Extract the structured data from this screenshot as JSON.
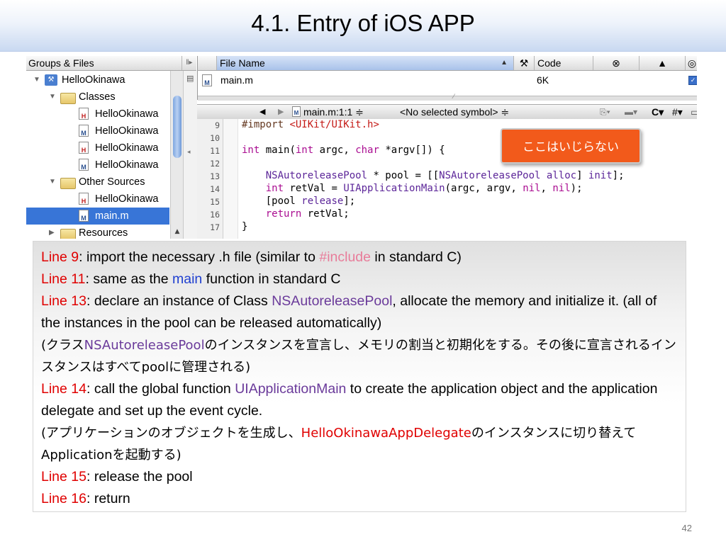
{
  "title": "4.1. Entry of iOS APP",
  "sidebar": {
    "header": "Groups & Files",
    "items": [
      {
        "label": "HelloOkinawa",
        "icon": "project-icon"
      },
      {
        "label": "Classes",
        "icon": "folder-icon"
      },
      {
        "label": "HelloOkinawa",
        "icon": "h-file-icon"
      },
      {
        "label": "HelloOkinawa",
        "icon": "m-file-icon"
      },
      {
        "label": "HelloOkinawa",
        "icon": "h-file-icon"
      },
      {
        "label": "HelloOkinawa",
        "icon": "m-file-icon"
      },
      {
        "label": "Other Sources",
        "icon": "folder-icon"
      },
      {
        "label": "HelloOkinawa",
        "icon": "h-file-icon"
      },
      {
        "label": "main.m",
        "icon": "m-file-icon"
      },
      {
        "label": "Resources",
        "icon": "folder-icon"
      }
    ]
  },
  "file_list": {
    "col_file_name": "File Name",
    "col_code": "Code",
    "row_file": "main.m",
    "row_code": "6K"
  },
  "navbar": {
    "location": "main.m:1:1 ≑",
    "symbol": "<No selected symbol> ≑",
    "c_menu": "C",
    "hash_menu": "#"
  },
  "editor": {
    "line_numbers": [
      "9",
      "10",
      "11",
      "12",
      "13",
      "14",
      "15",
      "16",
      "17"
    ]
  },
  "callout": "ここはいじらない",
  "explanation": {
    "line9_label": "Line 9",
    "line9_a": ": import the necessary .h file (similar to ",
    "line9_kw": "#include",
    "line9_b": " in standard C)",
    "line11_label": "Line 11",
    "line11_a": ": same as the ",
    "line11_kw": "main",
    "line11_b": " function in standard C",
    "line13_label": "Line 13",
    "line13_a": ": declare an instance of Class ",
    "line13_kw": "NSAutoreleasePool",
    "line13_b": ", allocate the memory and initialize it. (all of the instances in the pool can be released automatically)",
    "jp1_a": "(クラス",
    "jp1_kw": "NSAutoreleasePool",
    "jp1_b": "のインスタンスを宣言し、メモリの割当と初期化をする。その後に宣言されるインスタンスはすべてpoolに管理される)",
    "line14_label": "Line 14",
    "line14_a": ": call the global function ",
    "line14_kw": "UIApplicationMain",
    "line14_b": " to create the application object and the application delegate and set up the event cycle.",
    "jp2_a": "(アプリケーションのオブジェクトを生成し、",
    "jp2_kw": "HelloOkinawaAppDelegate",
    "jp2_b": "のインスタンスに切り替えてApplicationを起動する)",
    "line15_label": "Line 15",
    "line15_a": ": release the pool",
    "line16_label": "Line 16",
    "line16_a": ": return"
  },
  "page_number": "42"
}
